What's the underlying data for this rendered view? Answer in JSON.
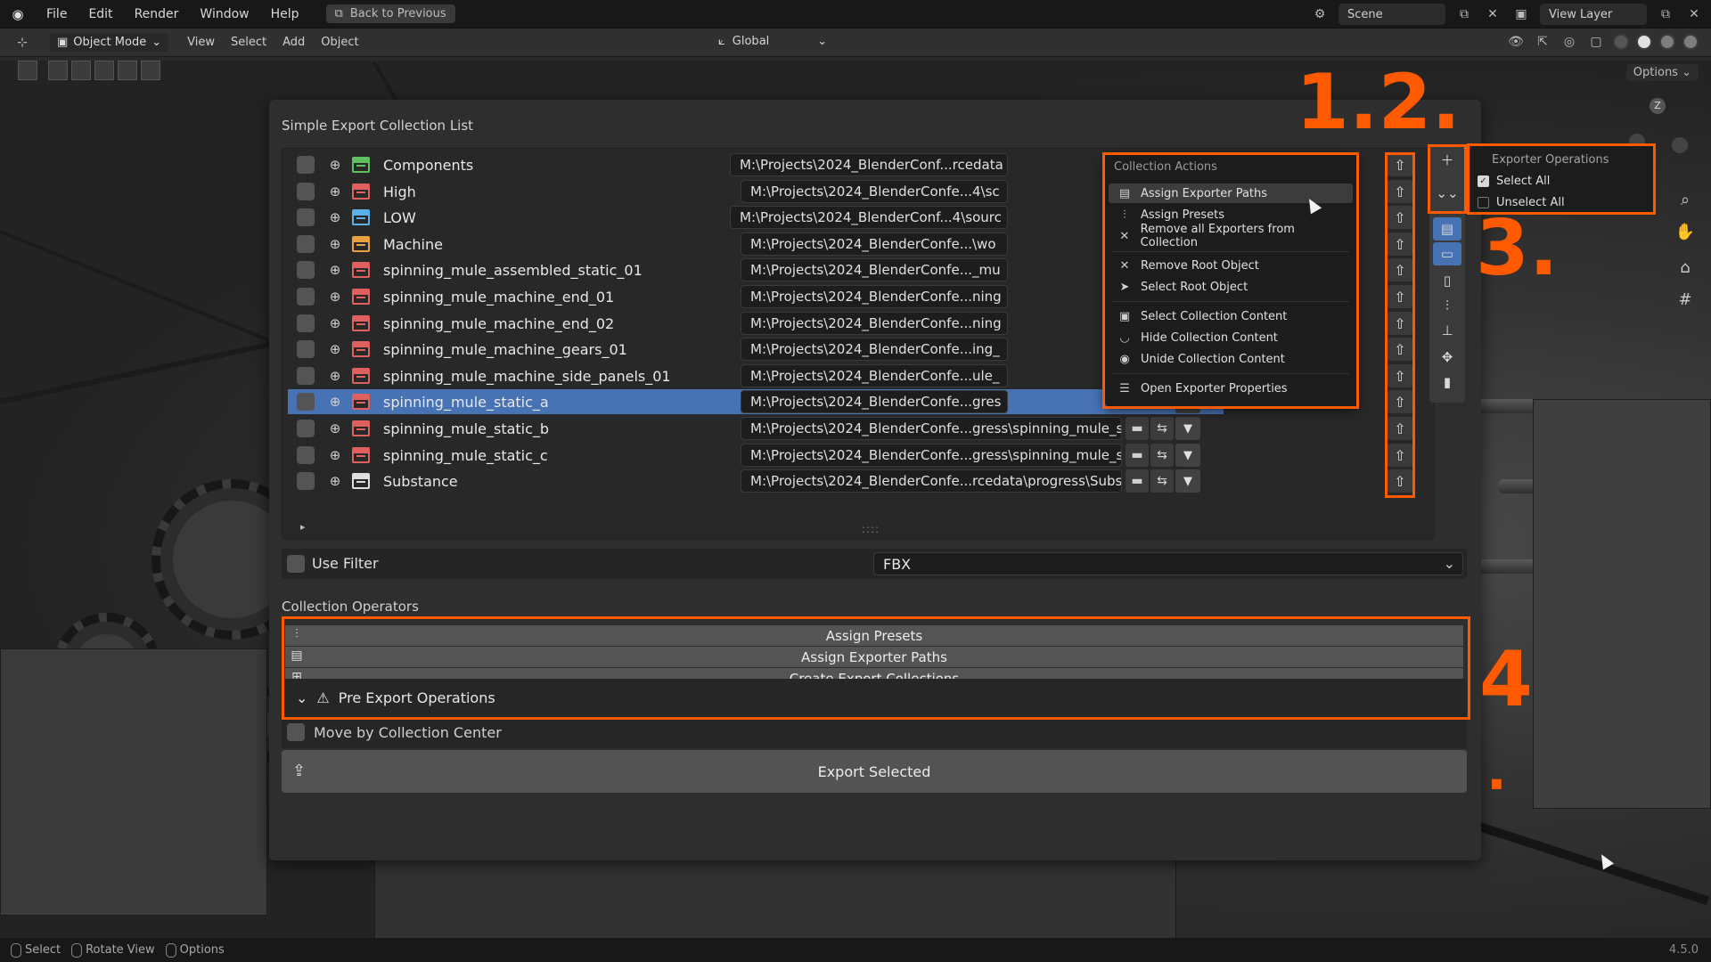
{
  "menubar": {
    "items": [
      "File",
      "Edit",
      "Render",
      "Window",
      "Help"
    ],
    "back_label": "Back to Previous",
    "scene": "Scene",
    "view_layer": "View Layer"
  },
  "header": {
    "mode": "Object Mode",
    "items": [
      "View",
      "Select",
      "Add",
      "Object"
    ],
    "transform": "Global",
    "options": "Options"
  },
  "panel": {
    "title": "Simple Export Collection List",
    "collections": [
      {
        "name": "Components",
        "color": "#5fbf5f",
        "path": "M:\\Projects\\2024_BlenderConf...rcedata"
      },
      {
        "name": "High",
        "color": "#e06060",
        "path": "M:\\Projects\\2024_BlenderConfe...4\\sc"
      },
      {
        "name": "LOW",
        "color": "#5ab0e8",
        "path": "M:\\Projects\\2024_BlenderConf...4\\sourc"
      },
      {
        "name": "Machine",
        "color": "#e8a040",
        "path": "M:\\Projects\\2024_BlenderConfe...\\wo"
      },
      {
        "name": "spinning_mule_assembled_static_01",
        "color": "#e06060",
        "path": "M:\\Projects\\2024_BlenderConfe..._mu"
      },
      {
        "name": "spinning_mule_machine_end_01",
        "color": "#e06060",
        "path": "M:\\Projects\\2024_BlenderConfe...ning"
      },
      {
        "name": "spinning_mule_machine_end_02",
        "color": "#e06060",
        "path": "M:\\Projects\\2024_BlenderConfe...ning"
      },
      {
        "name": "spinning_mule_machine_gears_01",
        "color": "#e06060",
        "path": "M:\\Projects\\2024_BlenderConfe...ing_"
      },
      {
        "name": "spinning_mule_machine_side_panels_01",
        "color": "#e06060",
        "path": "M:\\Projects\\2024_BlenderConfe...ule_"
      },
      {
        "name": "spinning_mule_static_a",
        "color": "#e06060",
        "path": "M:\\Projects\\2024_BlenderConfe...gres"
      },
      {
        "name": "spinning_mule_static_b",
        "color": "#e06060",
        "path": "M:\\Projects\\2024_BlenderConfe...gress\\spinning_mule_static_b.fbx"
      },
      {
        "name": "spinning_mule_static_c",
        "color": "#e06060",
        "path": "M:\\Projects\\2024_BlenderConfe...gress\\spinning_mule_static_c.fbx"
      },
      {
        "name": "Substance",
        "color": "#e0e0e0",
        "path": "M:\\Projects\\2024_BlenderConfe...rcedata\\progress\\Substance.fbx"
      }
    ],
    "selected_index": 9,
    "grip": "::::",
    "use_filter": "Use Filter",
    "format": "FBX",
    "collection_operators": "Collection Operators",
    "operators": [
      "Assign Presets",
      "Assign Exporter Paths",
      "Create Export Collections"
    ],
    "pre_export": "Pre Export Operations",
    "move_by_center": "Move by Collection Center",
    "export_selected": "Export Selected"
  },
  "collection_actions": {
    "title": "Collection Actions",
    "items": [
      "Assign Exporter Paths",
      "Assign Presets",
      "Remove all Exporters from Collection",
      "Remove Root Object",
      "Select Root Object",
      "Select Collection Content",
      "Hide Collection Content",
      "Unide Collection Content",
      "Open Exporter Properties"
    ]
  },
  "exporter_operations": {
    "title": "Exporter Operations",
    "select_all": "Select All",
    "unselect_all": "Unselect All"
  },
  "annotations": {
    "label_12": "1.2.",
    "label_3": "3.",
    "label_4": "4",
    "label_dot": "."
  },
  "statusbar": {
    "select": "Select",
    "rotate": "Rotate View",
    "options": "Options",
    "version": "4.5.0"
  },
  "accent": "#ff5a00",
  "selection_color": "#4772b3"
}
